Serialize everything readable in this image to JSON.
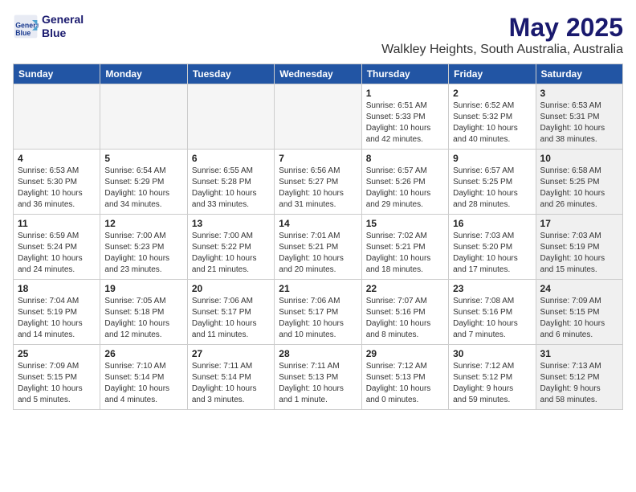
{
  "header": {
    "logo_line1": "General",
    "logo_line2": "Blue",
    "title": "May 2025",
    "subtitle": "Walkley Heights, South Australia, Australia"
  },
  "days_of_week": [
    "Sunday",
    "Monday",
    "Tuesday",
    "Wednesday",
    "Thursday",
    "Friday",
    "Saturday"
  ],
  "weeks": [
    [
      {
        "day": "",
        "info": "",
        "shaded": true
      },
      {
        "day": "",
        "info": "",
        "shaded": true
      },
      {
        "day": "",
        "info": "",
        "shaded": true
      },
      {
        "day": "",
        "info": "",
        "shaded": true
      },
      {
        "day": "1",
        "info": "Sunrise: 6:51 AM\nSunset: 5:33 PM\nDaylight: 10 hours\nand 42 minutes.",
        "shaded": false
      },
      {
        "day": "2",
        "info": "Sunrise: 6:52 AM\nSunset: 5:32 PM\nDaylight: 10 hours\nand 40 minutes.",
        "shaded": false
      },
      {
        "day": "3",
        "info": "Sunrise: 6:53 AM\nSunset: 5:31 PM\nDaylight: 10 hours\nand 38 minutes.",
        "shaded": true
      }
    ],
    [
      {
        "day": "4",
        "info": "Sunrise: 6:53 AM\nSunset: 5:30 PM\nDaylight: 10 hours\nand 36 minutes.",
        "shaded": false
      },
      {
        "day": "5",
        "info": "Sunrise: 6:54 AM\nSunset: 5:29 PM\nDaylight: 10 hours\nand 34 minutes.",
        "shaded": false
      },
      {
        "day": "6",
        "info": "Sunrise: 6:55 AM\nSunset: 5:28 PM\nDaylight: 10 hours\nand 33 minutes.",
        "shaded": false
      },
      {
        "day": "7",
        "info": "Sunrise: 6:56 AM\nSunset: 5:27 PM\nDaylight: 10 hours\nand 31 minutes.",
        "shaded": false
      },
      {
        "day": "8",
        "info": "Sunrise: 6:57 AM\nSunset: 5:26 PM\nDaylight: 10 hours\nand 29 minutes.",
        "shaded": false
      },
      {
        "day": "9",
        "info": "Sunrise: 6:57 AM\nSunset: 5:25 PM\nDaylight: 10 hours\nand 28 minutes.",
        "shaded": false
      },
      {
        "day": "10",
        "info": "Sunrise: 6:58 AM\nSunset: 5:25 PM\nDaylight: 10 hours\nand 26 minutes.",
        "shaded": true
      }
    ],
    [
      {
        "day": "11",
        "info": "Sunrise: 6:59 AM\nSunset: 5:24 PM\nDaylight: 10 hours\nand 24 minutes.",
        "shaded": false
      },
      {
        "day": "12",
        "info": "Sunrise: 7:00 AM\nSunset: 5:23 PM\nDaylight: 10 hours\nand 23 minutes.",
        "shaded": false
      },
      {
        "day": "13",
        "info": "Sunrise: 7:00 AM\nSunset: 5:22 PM\nDaylight: 10 hours\nand 21 minutes.",
        "shaded": false
      },
      {
        "day": "14",
        "info": "Sunrise: 7:01 AM\nSunset: 5:21 PM\nDaylight: 10 hours\nand 20 minutes.",
        "shaded": false
      },
      {
        "day": "15",
        "info": "Sunrise: 7:02 AM\nSunset: 5:21 PM\nDaylight: 10 hours\nand 18 minutes.",
        "shaded": false
      },
      {
        "day": "16",
        "info": "Sunrise: 7:03 AM\nSunset: 5:20 PM\nDaylight: 10 hours\nand 17 minutes.",
        "shaded": false
      },
      {
        "day": "17",
        "info": "Sunrise: 7:03 AM\nSunset: 5:19 PM\nDaylight: 10 hours\nand 15 minutes.",
        "shaded": true
      }
    ],
    [
      {
        "day": "18",
        "info": "Sunrise: 7:04 AM\nSunset: 5:19 PM\nDaylight: 10 hours\nand 14 minutes.",
        "shaded": false
      },
      {
        "day": "19",
        "info": "Sunrise: 7:05 AM\nSunset: 5:18 PM\nDaylight: 10 hours\nand 12 minutes.",
        "shaded": false
      },
      {
        "day": "20",
        "info": "Sunrise: 7:06 AM\nSunset: 5:17 PM\nDaylight: 10 hours\nand 11 minutes.",
        "shaded": false
      },
      {
        "day": "21",
        "info": "Sunrise: 7:06 AM\nSunset: 5:17 PM\nDaylight: 10 hours\nand 10 minutes.",
        "shaded": false
      },
      {
        "day": "22",
        "info": "Sunrise: 7:07 AM\nSunset: 5:16 PM\nDaylight: 10 hours\nand 8 minutes.",
        "shaded": false
      },
      {
        "day": "23",
        "info": "Sunrise: 7:08 AM\nSunset: 5:16 PM\nDaylight: 10 hours\nand 7 minutes.",
        "shaded": false
      },
      {
        "day": "24",
        "info": "Sunrise: 7:09 AM\nSunset: 5:15 PM\nDaylight: 10 hours\nand 6 minutes.",
        "shaded": true
      }
    ],
    [
      {
        "day": "25",
        "info": "Sunrise: 7:09 AM\nSunset: 5:15 PM\nDaylight: 10 hours\nand 5 minutes.",
        "shaded": false
      },
      {
        "day": "26",
        "info": "Sunrise: 7:10 AM\nSunset: 5:14 PM\nDaylight: 10 hours\nand 4 minutes.",
        "shaded": false
      },
      {
        "day": "27",
        "info": "Sunrise: 7:11 AM\nSunset: 5:14 PM\nDaylight: 10 hours\nand 3 minutes.",
        "shaded": false
      },
      {
        "day": "28",
        "info": "Sunrise: 7:11 AM\nSunset: 5:13 PM\nDaylight: 10 hours\nand 1 minute.",
        "shaded": false
      },
      {
        "day": "29",
        "info": "Sunrise: 7:12 AM\nSunset: 5:13 PM\nDaylight: 10 hours\nand 0 minutes.",
        "shaded": false
      },
      {
        "day": "30",
        "info": "Sunrise: 7:12 AM\nSunset: 5:12 PM\nDaylight: 9 hours\nand 59 minutes.",
        "shaded": false
      },
      {
        "day": "31",
        "info": "Sunrise: 7:13 AM\nSunset: 5:12 PM\nDaylight: 9 hours\nand 58 minutes.",
        "shaded": true
      }
    ]
  ]
}
